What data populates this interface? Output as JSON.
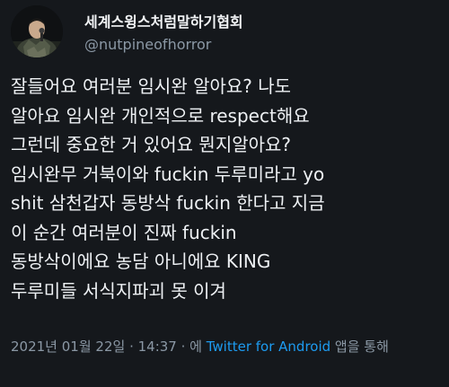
{
  "author": {
    "display_name": "세계스윙스처럼말하기협회",
    "handle": "@nutpineofhorror"
  },
  "tweet": {
    "lines": [
      "잘들어요 여러분 임시완 알아요? 나도",
      "알아요 임시완 개인적으로 respect해요",
      "그런데 중요한 거 있어요 뭔지알아요?",
      "임시완무 거북이와 fuckin 두루미라고 yo",
      "shit 삼천갑자 동방삭 fuckin 한다고 지금",
      "이 순간 여러분이 진짜 fuckin",
      "동방삭이에요 농담 아니에요 KING",
      "두루미들 서식지파괴 못 이겨"
    ]
  },
  "meta": {
    "date": "2021년 01월 22일",
    "sep1": " · ",
    "time": "14:37",
    "sep2": " · 에 ",
    "source": "Twitter for Android",
    "suffix": " 앱을 통해"
  },
  "colors": {
    "background": "#15181c",
    "text": "#eef1f4",
    "secondary": "#8b98a5",
    "link": "#1d9bf0"
  },
  "icons": {
    "avatar": "profile-photo-avatar"
  }
}
